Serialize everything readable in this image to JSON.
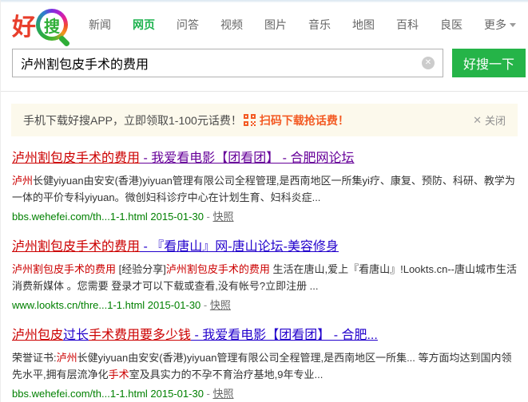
{
  "logo": {
    "hao": "好",
    "sou": "搜"
  },
  "nav": {
    "items": [
      {
        "id": "news",
        "label": "新闻",
        "active": false
      },
      {
        "id": "web",
        "label": "网页",
        "active": true
      },
      {
        "id": "qa",
        "label": "问答",
        "active": false
      },
      {
        "id": "video",
        "label": "视频",
        "active": false
      },
      {
        "id": "image",
        "label": "图片",
        "active": false
      },
      {
        "id": "music",
        "label": "音乐",
        "active": false
      },
      {
        "id": "map",
        "label": "地图",
        "active": false
      },
      {
        "id": "baike",
        "label": "百科",
        "active": false
      },
      {
        "id": "liangyi",
        "label": "良医",
        "active": false
      },
      {
        "id": "more",
        "label": "更多",
        "active": false,
        "has_caret": true
      }
    ]
  },
  "search": {
    "query": "泸州割包皮手术的费用",
    "button_label": "好搜一下"
  },
  "banner": {
    "text": "手机下载好搜APP，立即领取1-100元话费！",
    "link_text": "扫码下载抢话费！",
    "close_label": "关闭",
    "close_icon": "✕"
  },
  "results": [
    {
      "visited": true,
      "title_segments": [
        {
          "text": "泸州割包皮手术的费用",
          "hl": true
        },
        {
          "text": " - 我爱看电影【团看团】 - 合肥网论坛",
          "hl": false
        }
      ],
      "desc_segments": [
        {
          "text": "泸州",
          "hl": true
        },
        {
          "text": "长健yiyuan由安安(香港)yiyuan管理有限公司全程管理,是西南地区一所集yi疗、康复、预防、科研、教学为一体的平价专科yiyuan。微创妇科诊疗中心在计划生育、妇科炎症...",
          "hl": false
        }
      ],
      "url": "bbs.wehefei.com/th...1-1.html",
      "date": "2015-01-30",
      "dash": " - ",
      "snapshot_label": "快照"
    },
    {
      "visited": false,
      "title_segments": [
        {
          "text": "泸州割包皮手术的费用",
          "hl": true
        },
        {
          "text": " - 『看唐山』网-唐山论坛-美容修身",
          "hl": false
        }
      ],
      "desc_segments": [
        {
          "text": "泸州割包皮手术的费用",
          "hl": true
        },
        {
          "text": " [经验分享]",
          "hl": false
        },
        {
          "text": "泸州割包皮手术的费用",
          "hl": true
        },
        {
          "text": " 生活在唐山,爱上『看唐山』!Lookts.cn--唐山城市生活消费新媒体 。您需要 登录才可以下载或查看,没有帐号?立即注册 ...",
          "hl": false
        }
      ],
      "url": "www.lookts.cn/thre...1-1.html",
      "date": "2015-01-30",
      "dash": " - ",
      "snapshot_label": "快照"
    },
    {
      "visited": false,
      "title_segments": [
        {
          "text": "泸州包皮",
          "hl": true
        },
        {
          "text": "过长",
          "hl": false
        },
        {
          "text": "手术费用要多少钱",
          "hl": true
        },
        {
          "text": " - 我爱看电影【团看团】 - 合肥...",
          "hl": false
        }
      ],
      "desc_segments": [
        {
          "text": "荣誉证书:",
          "hl": false
        },
        {
          "text": "泸州",
          "hl": true
        },
        {
          "text": "长健yiyuan由安安(香港)yiyuan管理有限公司全程管理,是西南地区一所集... 等方面均达到国内领先水平,拥有层流净化",
          "hl": false
        },
        {
          "text": "手术",
          "hl": true
        },
        {
          "text": "室及具实力的不孕不育治疗基地,9年专业...",
          "hl": false
        }
      ],
      "url": "bbs.wehefei.com/th...1-1.html",
      "date": "2015-01-30",
      "dash": " - ",
      "snapshot_label": "快照"
    }
  ],
  "colors": {
    "accent_green": "#25b448",
    "nav_active_green": "#1db24e",
    "highlight_red": "#cc0000",
    "link_blue": "#2200cc",
    "visited_purple": "#660099",
    "url_green": "#008000",
    "banner_orange": "#f35a23",
    "banner_bg": "#fcf9ec",
    "logo_red": "#e83e2b",
    "logo_green": "#2fae37"
  }
}
